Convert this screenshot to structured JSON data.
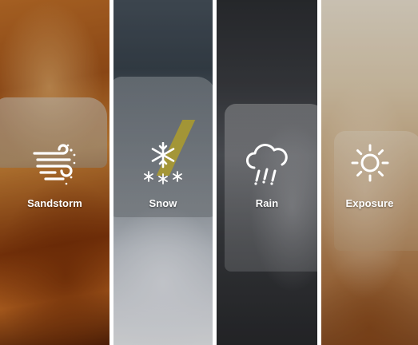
{
  "panels": [
    {
      "label": "Sandstorm",
      "icon": "sandstorm-icon"
    },
    {
      "label": "Snow",
      "icon": "snowflake-icon"
    },
    {
      "label": "Rain",
      "icon": "rain-cloud-icon"
    },
    {
      "label": "Exposure",
      "icon": "sun-icon"
    }
  ],
  "colors": {
    "text": "#ffffff",
    "divider": "#ffffff"
  }
}
